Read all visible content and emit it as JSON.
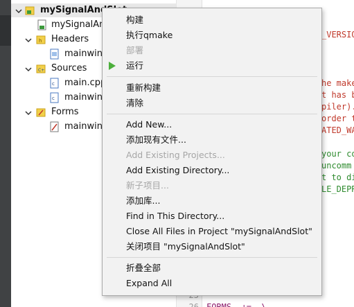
{
  "project_tree": {
    "project_name": "mySignalAndSlot",
    "pro_file": "mySignalAnd",
    "headers_label": "Headers",
    "header_file": "mainwind",
    "sources_label": "Sources",
    "source_files": [
      "main.cpp",
      "mainwind"
    ],
    "forms_label": "Forms",
    "form_file": "mainwind"
  },
  "editor": {
    "fragments": [
      "_VERSIO",
      "he make",
      "t has b",
      "piler).",
      "order t",
      "ATED_WA",
      "your co",
      "uncomm",
      "t to di",
      "LE_DEPR"
    ],
    "line_numbers": [
      "25",
      "26"
    ],
    "last_line": "FORMS  +=  \\"
  },
  "context_menu": {
    "items": [
      {
        "label": "构建",
        "enabled": true
      },
      {
        "label": "执行qmake",
        "enabled": true
      },
      {
        "label": "部署",
        "enabled": false
      },
      {
        "label": "运行",
        "enabled": true,
        "icon": "run-icon"
      },
      {
        "label": "重新构建",
        "enabled": true
      },
      {
        "label": "清除",
        "enabled": true
      },
      {
        "label": "Add New...",
        "enabled": true
      },
      {
        "label": "添加现有文件...",
        "enabled": true
      },
      {
        "label": "Add Existing Projects...",
        "enabled": false
      },
      {
        "label": "Add Existing Directory...",
        "enabled": true
      },
      {
        "label": "新子项目...",
        "enabled": false
      },
      {
        "label": "添加库...",
        "enabled": true
      },
      {
        "label": "Find in This Directory...",
        "enabled": true
      },
      {
        "label": "Close All Files in Project \"mySignalAndSlot\"",
        "enabled": true
      },
      {
        "label": "关闭项目 \"mySignalAndSlot\"",
        "enabled": true
      },
      {
        "label": "折叠全部",
        "enabled": true
      },
      {
        "label": "Expand All",
        "enabled": true
      }
    ]
  },
  "colors": {
    "run_icon": "#4caf3c",
    "code_red": "#c0392b",
    "code_green": "#2e8b2e"
  }
}
